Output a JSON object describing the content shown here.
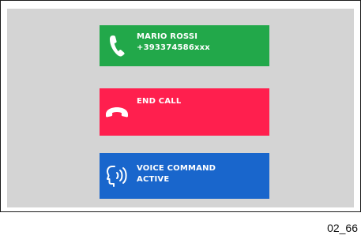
{
  "call": {
    "caller_name": "MARIO ROSSI",
    "caller_number": "+393374586xxx",
    "end_call_label": "END CALL",
    "voice_line1": "VOICE COMMAND",
    "voice_line2": "ACTIVE"
  },
  "figure_ref": "02_66",
  "colors": {
    "screen_bg": "#d4d4d4",
    "caller_tile": "#22a84a",
    "end_call_tile": "#ff1f4e",
    "voice_tile": "#1966cc",
    "text": "#ffffff"
  },
  "icons": {
    "caller": "phone-handset-icon",
    "end_call": "hang-up-icon",
    "voice": "voice-command-icon"
  }
}
